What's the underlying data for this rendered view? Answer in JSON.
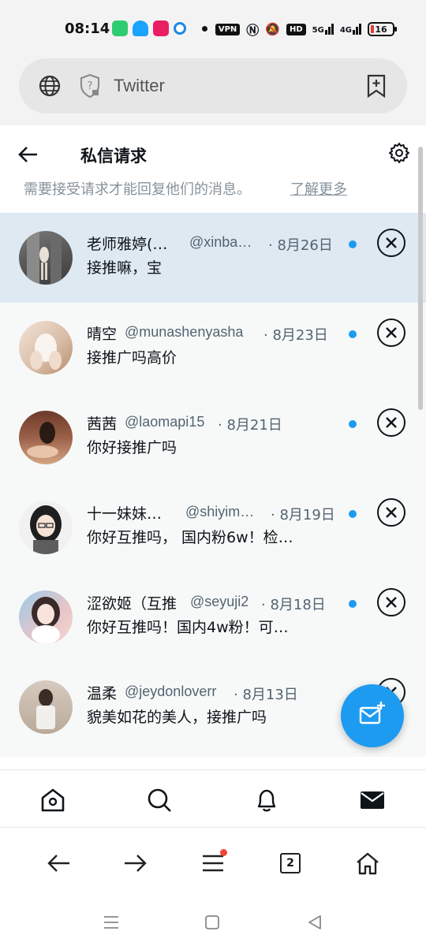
{
  "status_bar": {
    "time": "08:14",
    "vpn_label": "VPN",
    "hd_label": "HD",
    "net_5g": "5G",
    "net_4g": "4G",
    "battery": "16"
  },
  "browser": {
    "url_text": "Twitter",
    "tab_count": "2"
  },
  "header": {
    "title": "私信请求"
  },
  "cut_banner": {
    "text": "需要接受请求才能回复他们的消息。",
    "link": "了解更多"
  },
  "requests": [
    {
      "name": "老师雅婷(…",
      "handle": "@xinba…",
      "date": "· 8月26日",
      "message": "接推嘛，宝",
      "selected": true
    },
    {
      "name": "晴空",
      "handle": "@munashenyasha",
      "date": "· 8月23日",
      "message": "接推广吗高价",
      "selected": false
    },
    {
      "name": "茜茜",
      "handle": "@laomapi15",
      "date": "· 8月21日",
      "message": "你好接推广吗",
      "selected": false
    },
    {
      "name": "十一妹妹…",
      "handle": "@shiyim…",
      "date": "· 8月19日",
      "message": "你好互推吗， 国内粉6w！检…",
      "selected": false
    },
    {
      "name": "涩欲姬（互推",
      "handle": "@seyuji2",
      "date": "· 8月18日",
      "message": "你好互推吗！国内4w粉！可…",
      "selected": false
    },
    {
      "name": "温柔",
      "handle": "@jeydonloverr",
      "date": "· 8月13日",
      "message": "貌美如花的美人，接推广吗",
      "selected": false
    }
  ],
  "colors": {
    "accent": "#1d9bf0",
    "selected_row": "#dfe9f2",
    "list_bg": "#f7f9f9",
    "secondary_text": "#536471"
  },
  "icons": {
    "twitter_nav": [
      "home-icon",
      "search-icon",
      "bell-icon",
      "mail-icon"
    ],
    "browser_nav": [
      "back-arrow-icon",
      "forward-arrow-icon",
      "menu-icon",
      "tabs-icon",
      "home-icon"
    ],
    "system_nav": [
      "recents-icon",
      "home-icon",
      "back-icon"
    ]
  }
}
